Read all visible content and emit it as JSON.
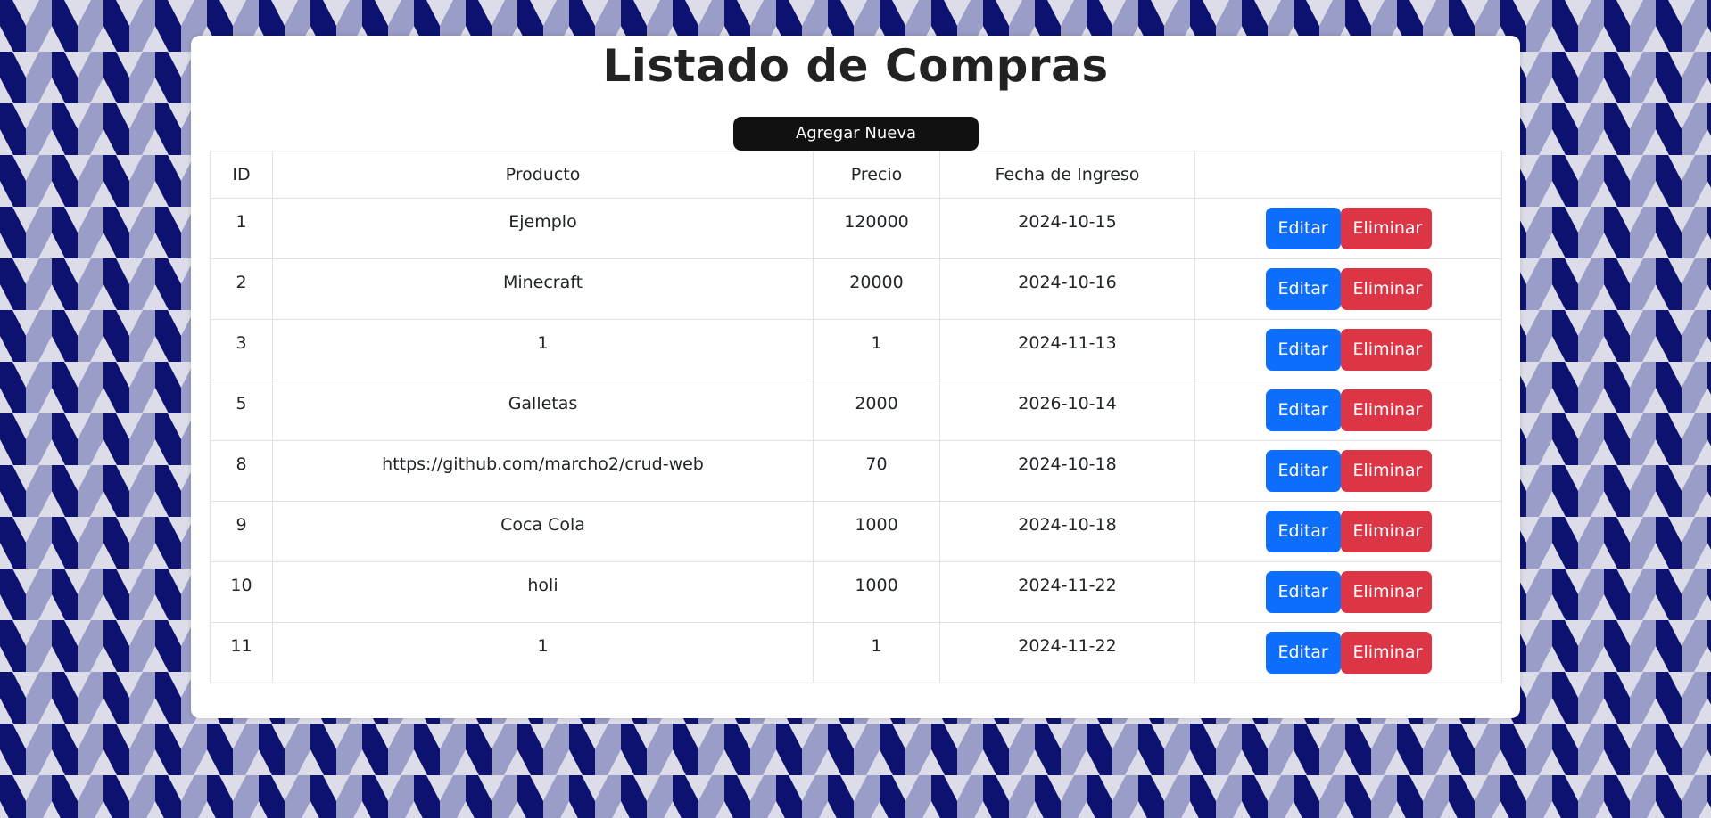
{
  "page": {
    "title": "Listado de Compras",
    "add_button_label": "Agregar Nueva"
  },
  "colors": {
    "background_dark": "#0d1270",
    "background_mid": "#9a9dc7",
    "background_light": "#dcdde8",
    "edit_button": "#0d6efd",
    "delete_button": "#dc3545",
    "add_button": "#111111"
  },
  "table": {
    "headers": {
      "id": "ID",
      "producto": "Producto",
      "precio": "Precio",
      "fecha": "Fecha de Ingreso",
      "acciones": ""
    },
    "rows": [
      {
        "id": "1",
        "producto": "Ejemplo",
        "precio": "120000",
        "fecha": "2024-10-15",
        "edit": "Editar",
        "delete": "Eliminar"
      },
      {
        "id": "2",
        "producto": "Minecraft",
        "precio": "20000",
        "fecha": "2024-10-16",
        "edit": "Editar",
        "delete": "Eliminar"
      },
      {
        "id": "3",
        "producto": "1",
        "precio": "1",
        "fecha": "2024-11-13",
        "edit": "Editar",
        "delete": "Eliminar"
      },
      {
        "id": "5",
        "producto": "Galletas",
        "precio": "2000",
        "fecha": "2026-10-14",
        "edit": "Editar",
        "delete": "Eliminar"
      },
      {
        "id": "8",
        "producto": "https://github.com/marcho2/crud-web",
        "precio": "70",
        "fecha": "2024-10-18",
        "edit": "Editar",
        "delete": "Eliminar"
      },
      {
        "id": "9",
        "producto": "Coca Cola",
        "precio": "1000",
        "fecha": "2024-10-18",
        "edit": "Editar",
        "delete": "Eliminar"
      },
      {
        "id": "10",
        "producto": "holi",
        "precio": "1000",
        "fecha": "2024-11-22",
        "edit": "Editar",
        "delete": "Eliminar"
      },
      {
        "id": "11",
        "producto": "1",
        "precio": "1",
        "fecha": "2024-11-22",
        "edit": "Editar",
        "delete": "Eliminar"
      }
    ]
  }
}
